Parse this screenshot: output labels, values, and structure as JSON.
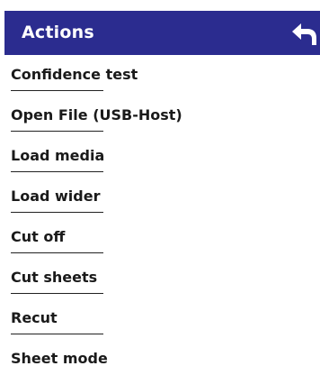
{
  "header": {
    "title": "Actions",
    "back_icon": "back-arrow-icon",
    "background_color": "#2b2c8f"
  },
  "menu": {
    "items": [
      {
        "label": "Confidence test"
      },
      {
        "label": "Open File (USB-Host)"
      },
      {
        "label": "Load media"
      },
      {
        "label": "Load wider"
      },
      {
        "label": "Cut off"
      },
      {
        "label": "Cut sheets"
      },
      {
        "label": "Recut"
      },
      {
        "label": "Sheet mode"
      }
    ]
  }
}
